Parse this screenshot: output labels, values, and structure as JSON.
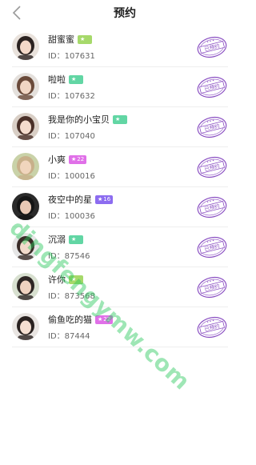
{
  "header": {
    "title": "预约"
  },
  "colors": {
    "badge_green": "#a6d96a",
    "badge_teal": "#62d6a4",
    "badge_pink": "#e070e8",
    "badge_purple": "#8c6cf0",
    "stamp_purple": "#8a4fc2"
  },
  "stamp_text": "已预约",
  "users": [
    {
      "name": "甜蜜蜜",
      "badge": "",
      "badge_color": "#a6d96a",
      "id": "ID：107631"
    },
    {
      "name": "啦啦",
      "badge": "",
      "badge_color": "#62d6a4",
      "id": "ID：107632"
    },
    {
      "name": "我是你的小宝贝",
      "badge": "",
      "badge_color": "#62d6a4",
      "id": "ID：107040"
    },
    {
      "name": "小爽",
      "badge": "22",
      "badge_color": "#e070e8",
      "id": "ID：100016"
    },
    {
      "name": "夜空中的星",
      "badge": "16",
      "badge_color": "#8c6cf0",
      "id": "ID：100036"
    },
    {
      "name": "沉溺",
      "badge": "",
      "badge_color": "#62d6a4",
      "id": "ID：87546"
    },
    {
      "name": "许你",
      "badge": "",
      "badge_color": "#a6d96a",
      "id": "ID：873568"
    },
    {
      "name": "偷鱼吃的猫",
      "badge": "22",
      "badge_color": "#e070e8",
      "id": "ID：87444"
    }
  ],
  "watermark": "dingfengymw.com"
}
